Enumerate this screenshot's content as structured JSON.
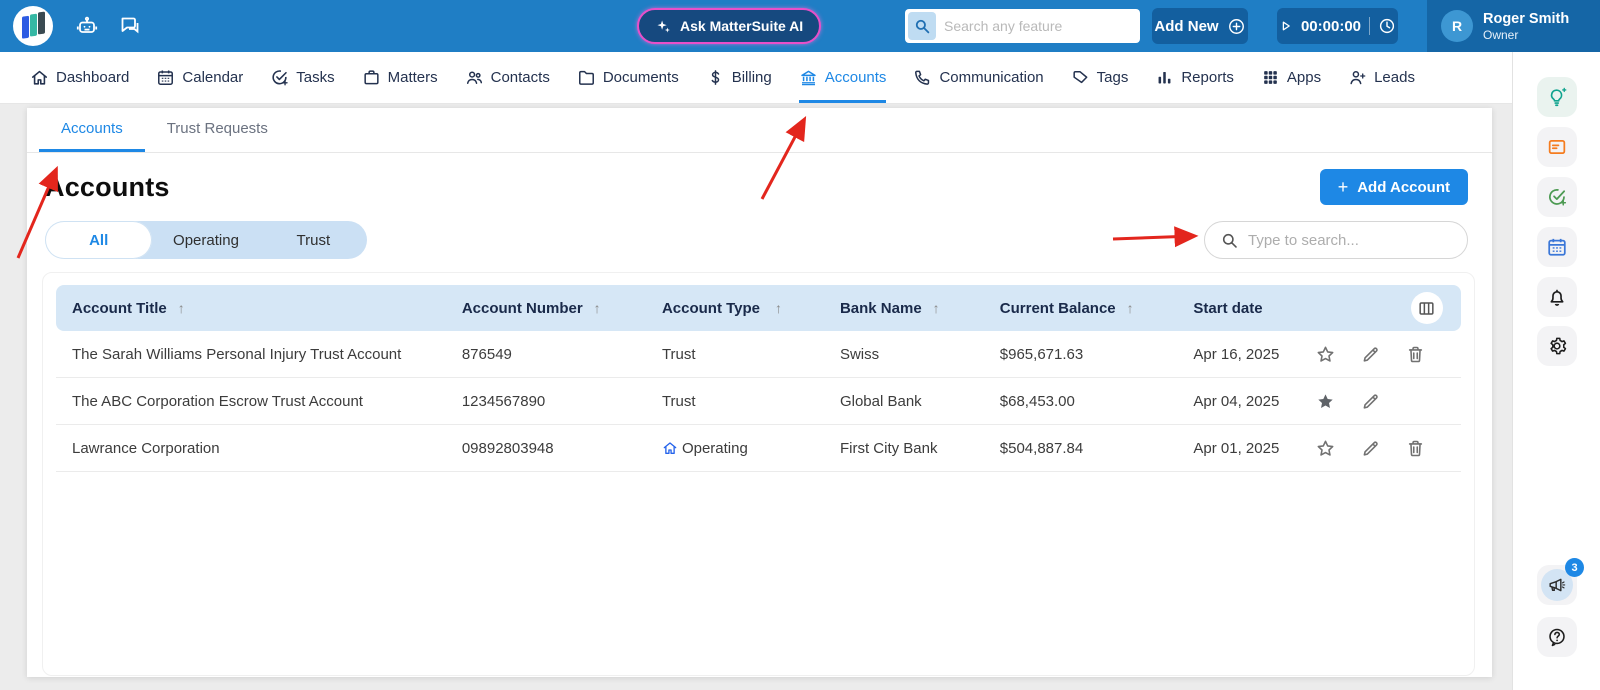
{
  "header": {
    "ai_button": "Ask MatterSuite AI",
    "search_placeholder": "Search any feature",
    "add_new_label": "Add New",
    "timer_value": "00:00:00",
    "user": {
      "initial": "R",
      "name": "Roger Smith",
      "role": "Owner"
    }
  },
  "nav": {
    "items": [
      {
        "label": "Dashboard",
        "icon": "home",
        "active": false
      },
      {
        "label": "Calendar",
        "icon": "calendar",
        "active": false
      },
      {
        "label": "Tasks",
        "icon": "tasks",
        "active": false
      },
      {
        "label": "Matters",
        "icon": "briefcase",
        "active": false
      },
      {
        "label": "Contacts",
        "icon": "contacts",
        "active": false
      },
      {
        "label": "Documents",
        "icon": "folder",
        "active": false
      },
      {
        "label": "Billing",
        "icon": "dollar",
        "active": false
      },
      {
        "label": "Accounts",
        "icon": "bank",
        "active": true
      },
      {
        "label": "Communication",
        "icon": "phone",
        "active": false
      },
      {
        "label": "Tags",
        "icon": "tag",
        "active": false
      },
      {
        "label": "Reports",
        "icon": "chart",
        "active": false
      },
      {
        "label": "Apps",
        "icon": "grid",
        "active": false
      },
      {
        "label": "Leads",
        "icon": "person-plus",
        "active": false
      }
    ]
  },
  "subtabs": [
    {
      "label": "Accounts",
      "active": true
    },
    {
      "label": "Trust Requests",
      "active": false
    }
  ],
  "page": {
    "title": "Accounts",
    "add_button": "Add Account",
    "search_placeholder": "Type to search...",
    "filters": [
      {
        "label": "All",
        "active": true
      },
      {
        "label": "Operating",
        "active": false
      },
      {
        "label": "Trust",
        "active": false
      }
    ]
  },
  "table": {
    "columns": [
      {
        "label": "Account Title",
        "sortable": true
      },
      {
        "label": "Account Number",
        "sortable": true
      },
      {
        "label": "Account Type",
        "sortable": true
      },
      {
        "label": "Bank Name",
        "sortable": true
      },
      {
        "label": "Current Balance",
        "sortable": true
      },
      {
        "label": "Start date",
        "sortable": false
      }
    ],
    "rows": [
      {
        "title": "The Sarah Williams Personal Injury Trust Account",
        "number": "876549",
        "type": "Trust",
        "type_icon": "",
        "bank": "Swiss",
        "balance": "$965,671.63",
        "date": "Apr 16, 2025",
        "starred": false,
        "has_delete": true
      },
      {
        "title": "The ABC Corporation Escrow Trust Account",
        "number": "1234567890",
        "type": "Trust",
        "type_icon": "",
        "bank": "Global Bank",
        "balance": "$68,453.00",
        "date": "Apr 04, 2025",
        "starred": true,
        "has_delete": false
      },
      {
        "title": "Lawrance Corporation",
        "number": "09892803948",
        "type": "Operating",
        "type_icon": "home",
        "bank": "First City Bank",
        "balance": "$504,887.84",
        "date": "Apr 01, 2025",
        "starred": false,
        "has_delete": true
      }
    ]
  },
  "sidebar": {
    "top_items": [
      {
        "name": "ideas",
        "icon": "bulb",
        "color": "#0FA38E",
        "bg": "#EAF3EF"
      },
      {
        "name": "notes",
        "icon": "note",
        "color": "#F57C1F",
        "bg": "#F3F3F5"
      },
      {
        "name": "add-task",
        "icon": "check-plus",
        "color": "#4C9A52",
        "bg": "#F3F3F5"
      },
      {
        "name": "calendar",
        "icon": "calendar",
        "color": "#3B77D8",
        "bg": "#F3F3F5"
      },
      {
        "name": "notifications",
        "icon": "bell",
        "color": "#1d1d1d",
        "bg": "#F3F3F5"
      },
      {
        "name": "settings",
        "icon": "gear",
        "color": "#1d1d1d",
        "bg": "#F3F3F5"
      }
    ],
    "announcement_badge": "3"
  },
  "colors": {
    "header_blue": "#1F7EC5",
    "accent_blue": "#1E88E5",
    "arrow_red": "#E3261D"
  }
}
